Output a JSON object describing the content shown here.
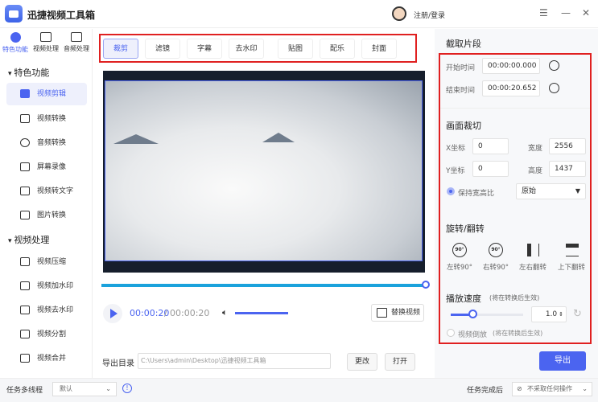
{
  "app": {
    "title": "迅捷视频工具箱",
    "login": "注册/登录",
    "window_controls": [
      "☰",
      "—",
      "✕"
    ]
  },
  "sidebar": {
    "top_tabs": [
      "特色功能",
      "视频处理",
      "音频处理"
    ],
    "groups": [
      {
        "label": "特色功能",
        "items": [
          "视频剪辑",
          "视频转换",
          "音频转换",
          "屏幕录像",
          "视频转文字",
          "图片转换"
        ]
      },
      {
        "label": "视频处理",
        "items": [
          "视频压缩",
          "视频加水印",
          "视频去水印",
          "视频分割",
          "视频合并"
        ]
      }
    ]
  },
  "tabs": [
    "裁剪",
    "滤镜",
    "字幕",
    "去水印",
    "贴图",
    "配乐",
    "封面"
  ],
  "player": {
    "current": "00:00:20",
    "separator": "/",
    "total": "00:00:20",
    "progress": 1.0,
    "volume": 1.0,
    "replace_label": "替换视频"
  },
  "export_dir": {
    "label": "导出目录",
    "path": "C:\\Users\\admin\\Desktop\\迅捷视频工具箱",
    "change": "更改",
    "open": "打开"
  },
  "panel": {
    "clip_title": "截取片段",
    "start_label": "开始时间",
    "start": "00:00:00.000",
    "end_label": "结束时间",
    "end": "00:00:20.652",
    "crop_title": "画面裁切",
    "x_label": "X坐标",
    "x": "0",
    "y_label": "Y坐标",
    "y": "0",
    "w_label": "宽度",
    "w": "2556",
    "h_label": "高度",
    "h": "1437",
    "keep_ratio": "保持宽高比",
    "ratio": "原始",
    "rotate_title": "旋转/翻转",
    "rotate_items": [
      "左转90°",
      "右转90°",
      "左右翻转",
      "上下翻转"
    ],
    "rot_icon": "90°",
    "speed_title": "播放速度",
    "speed_note": "(将在转换后生效)",
    "speed": "1.0",
    "speed_fraction": 0.3,
    "reverse": "视频倒放",
    "reverse_note": "(将在转换后生效)",
    "export": "导出"
  },
  "bottom": {
    "threads_label": "任务多线程",
    "threads": "默认",
    "after_label": "任务完成后",
    "after": "不采取任何操作"
  },
  "colors": {
    "accent": "#4b64f0",
    "highlight": "#e02020",
    "progress": "#1ba2dc"
  }
}
